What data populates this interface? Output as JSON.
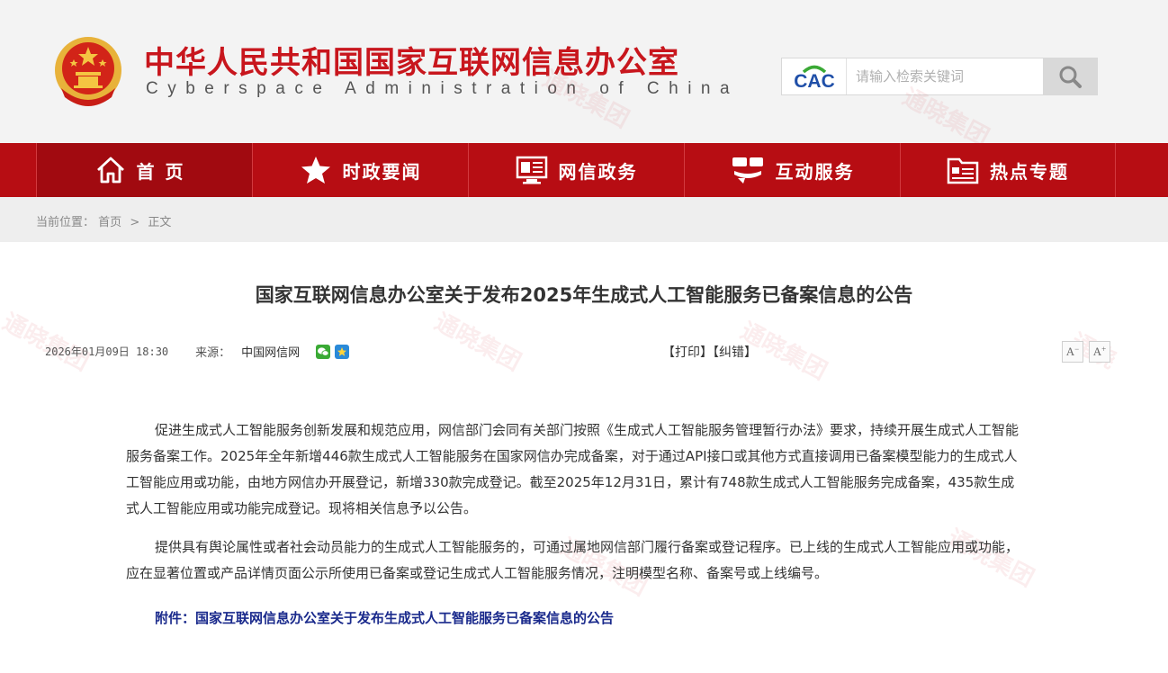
{
  "header": {
    "title_cn": "中华人民共和国国家互联网信息办公室",
    "title_en": "Cyberspace Administration of China",
    "logo_text": "CAC",
    "search_placeholder": "请输入检索关键词"
  },
  "nav": {
    "items": [
      {
        "label": "首页",
        "icon": "home-icon"
      },
      {
        "label": "时政要闻",
        "icon": "star-icon"
      },
      {
        "label": "网信政务",
        "icon": "monitor-icon"
      },
      {
        "label": "互动服务",
        "icon": "chat-icon"
      },
      {
        "label": "热点专题",
        "icon": "folder-icon"
      }
    ]
  },
  "breadcrumb": {
    "prefix": "当前位置：",
    "home": "首页",
    "separator": ">",
    "current": "正文"
  },
  "article": {
    "title": "国家互联网信息办公室关于发布2025年生成式人工智能服务已备案信息的公告",
    "date": "2026年01月09日 18:30",
    "source_label": "来源：",
    "source": "中国网信网",
    "print_label": "【打印】",
    "correct_label": "【纠错】",
    "font_decrease": "A",
    "font_increase": "A",
    "paragraphs": [
      "促进生成式人工智能服务创新发展和规范应用，网信部门会同有关部门按照《生成式人工智能服务管理暂行办法》要求，持续开展生成式人工智能服务备案工作。2025年全年新增446款生成式人工智能服务在国家网信办完成备案，对于通过API接口或其他方式直接调用已备案模型能力的生成式人工智能应用或功能，由地方网信办开展登记，新增330款完成登记。截至2025年12月31日，累计有748款生成式人工智能服务完成备案，435款生成式人工智能应用或功能完成登记。现将相关信息予以公告。",
      "提供具有舆论属性或者社会动员能力的生成式人工智能服务的，可通过属地网信部门履行备案或登记程序。已上线的生成式人工智能应用或功能，应在显著位置或产品详情页面公示所使用已备案或登记生成式人工智能服务情况，注明模型名称、备案号或上线编号。"
    ],
    "attachment_label": "附件：",
    "attachment_title": "国家互联网信息办公室关于发布生成式人工智能服务已备案信息的公告"
  },
  "colors": {
    "brand_red": "#c8161d",
    "nav_red": "#b70d13",
    "link_blue": "#1a2a8c"
  }
}
